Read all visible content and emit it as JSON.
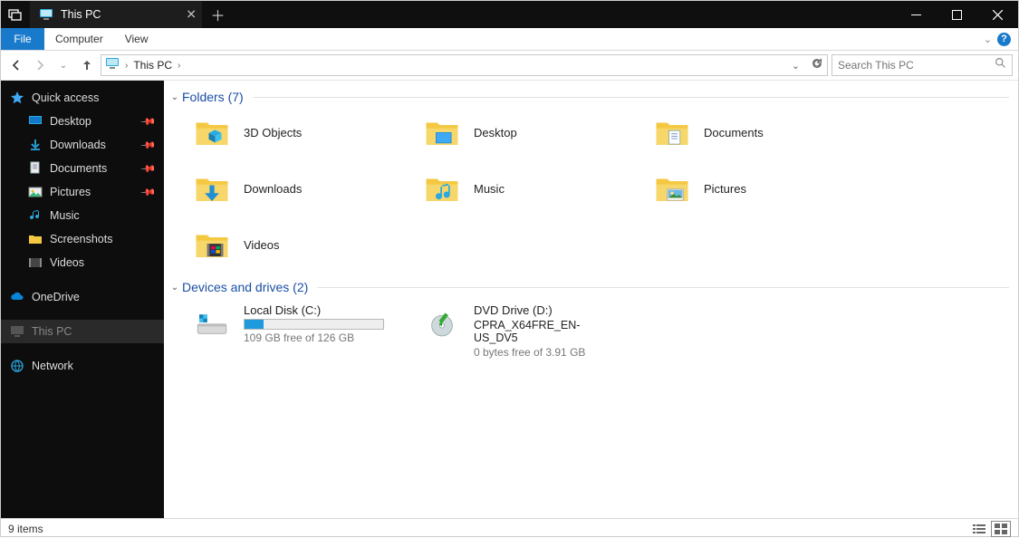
{
  "titlebar": {
    "title": "This PC"
  },
  "ribbon": {
    "file": "File",
    "items": [
      "Computer",
      "View"
    ]
  },
  "address": {
    "crumb": "This PC"
  },
  "search": {
    "placeholder": "Search This PC"
  },
  "sidebar": {
    "quick_access": "Quick access",
    "quick_items": [
      {
        "label": "Desktop"
      },
      {
        "label": "Downloads"
      },
      {
        "label": "Documents"
      },
      {
        "label": "Pictures"
      },
      {
        "label": "Music"
      },
      {
        "label": "Screenshots"
      },
      {
        "label": "Videos"
      }
    ],
    "onedrive": "OneDrive",
    "this_pc": "This PC",
    "network": "Network"
  },
  "groups": {
    "folders": {
      "title": "Folders (7)",
      "items": [
        "3D Objects",
        "Desktop",
        "Documents",
        "Downloads",
        "Music",
        "Pictures",
        "Videos"
      ]
    },
    "drives": {
      "title": "Devices and drives (2)",
      "items": [
        {
          "name": "Local Disk (C:)",
          "free_text": "109 GB free of 126 GB",
          "fill_pct": 14
        },
        {
          "name": "DVD Drive (D:)",
          "sub": "CPRA_X64FRE_EN-US_DV5",
          "free_text": "0 bytes free of 3.91 GB"
        }
      ]
    }
  },
  "statusbar": {
    "count_text": "9 items"
  }
}
